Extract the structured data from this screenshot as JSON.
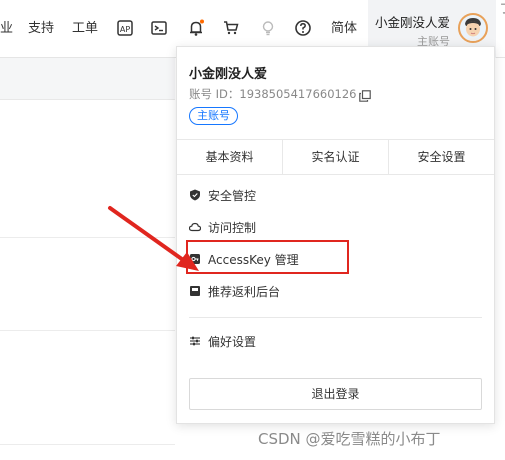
{
  "nav": {
    "items": [
      {
        "label": "业"
      },
      {
        "label": "支持"
      },
      {
        "label": "工单"
      }
    ],
    "icons": [
      "ap-icon",
      "terminal-icon",
      "bell-icon",
      "cart-icon",
      "bulb-icon",
      "help-icon"
    ],
    "lang": "简体",
    "notification_dot_color": "#ff6a00"
  },
  "user": {
    "name": "小金刚没人爱",
    "role": "主账号"
  },
  "edge_text": "了",
  "panel": {
    "name": "小金刚没人爱",
    "account_id": "账号 ID：1938505417660126",
    "badge": "主账号",
    "tabs": [
      "基本资料",
      "实名认证",
      "安全设置"
    ],
    "menu": [
      {
        "label": "安全管控",
        "icon": "shield-icon"
      },
      {
        "label": "访问控制",
        "icon": "cloud-icon"
      },
      {
        "label": "AccessKey 管理",
        "icon": "key-icon"
      },
      {
        "label": "推荐返利后台",
        "icon": "gift-icon"
      },
      {
        "label": "偏好设置",
        "icon": "sliders-icon"
      }
    ],
    "logout": "退出登录"
  },
  "annotation_color": "#e0261f",
  "watermark": "CSDN @爱吃雪糕的小布丁"
}
